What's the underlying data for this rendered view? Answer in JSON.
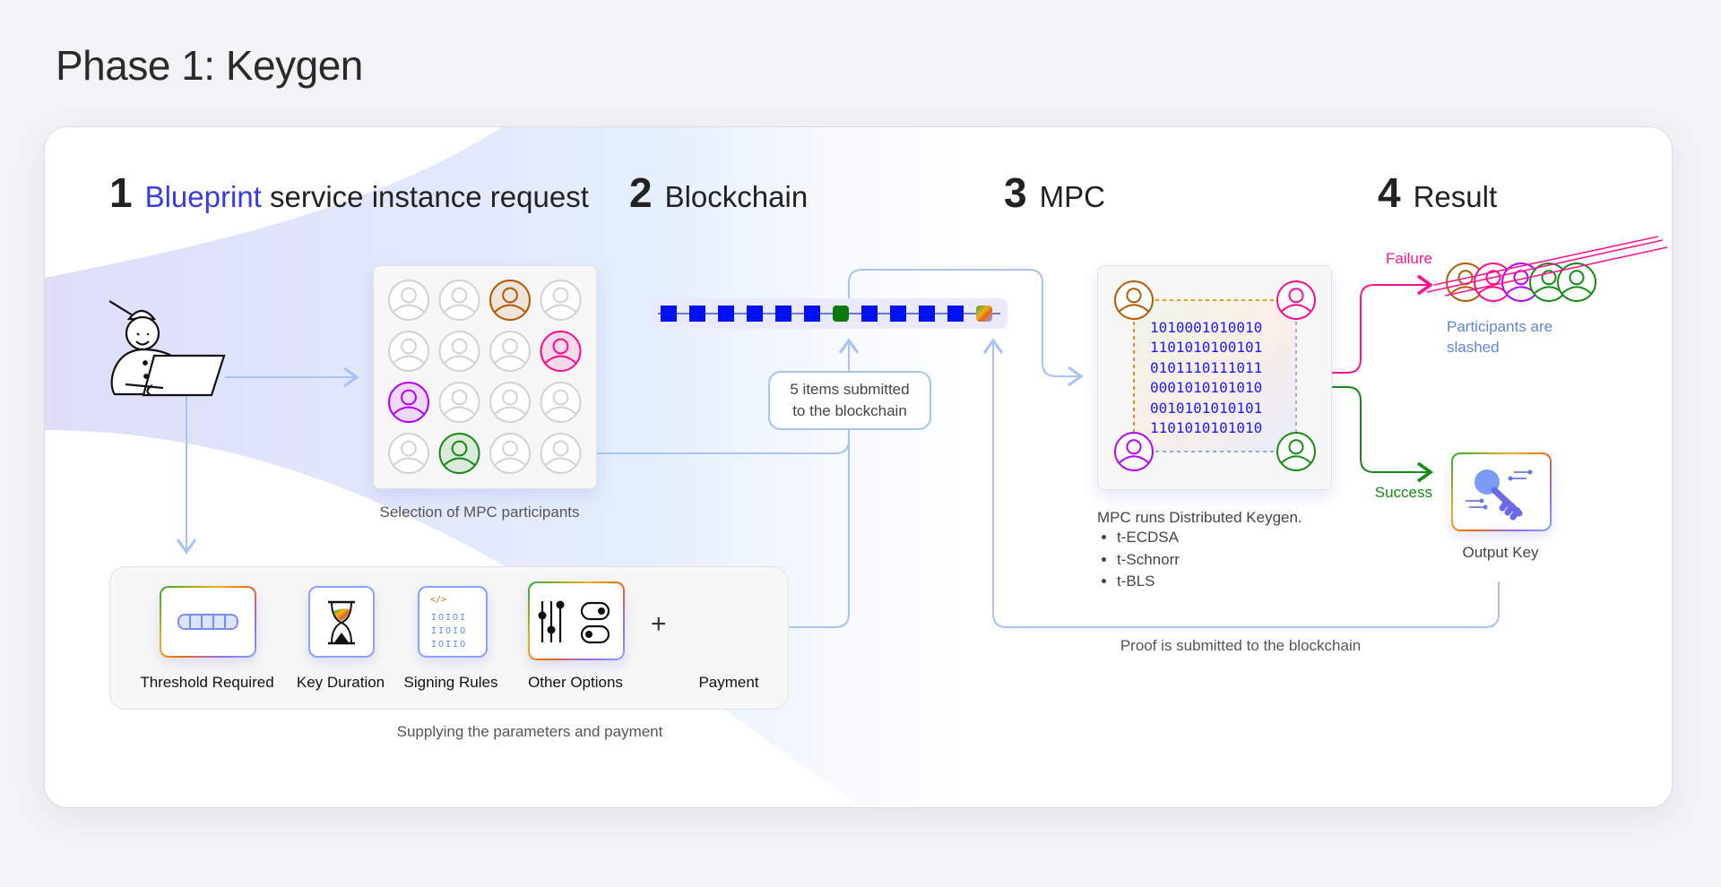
{
  "title": "Phase 1: Keygen",
  "steps": [
    {
      "number": "1",
      "accent": "Blueprint",
      "text": " service instance request"
    },
    {
      "number": "2",
      "text": "Blockchain"
    },
    {
      "number": "3",
      "text": "MPC"
    },
    {
      "number": "4",
      "text": "Result"
    }
  ],
  "colors": {
    "accent": "#3a3ae8",
    "failure": "#ff1493",
    "success": "#178a17",
    "connector": "#a9c4f3",
    "block": "#0010f5",
    "block_highlight": "#0a7a0a",
    "inactive": "#d2d2d2"
  },
  "participants": {
    "caption": "Selection of MPC participants",
    "grid": [
      [
        "inactive",
        "inactive",
        "#b35a00",
        "inactive"
      ],
      [
        "inactive",
        "inactive",
        "inactive",
        "#ff0a8c"
      ],
      [
        "#b300ff",
        "inactive",
        "inactive",
        "inactive"
      ],
      [
        "inactive",
        "#148a14",
        "inactive",
        "inactive"
      ]
    ]
  },
  "blockchain": {
    "blocks": [
      "blue",
      "blue",
      "blue",
      "blue",
      "blue",
      "blue",
      "green",
      "blue",
      "blue",
      "blue",
      "blue",
      "gradient"
    ],
    "callout": [
      "5 items submitted",
      "to the blockchain"
    ]
  },
  "mpc": {
    "corners": [
      "#b35a00",
      "#ff0a8c",
      "#b300ff",
      "#148a14"
    ],
    "binary": [
      "1010001010010",
      "1101010100101",
      "0101110111011",
      "0001010101010",
      "0010101010101",
      "1101010101010"
    ],
    "caption": "MPC runs Distributed Keygen.",
    "algorithms": [
      "t-ECDSA",
      "t-Schnorr",
      "t-BLS"
    ]
  },
  "result": {
    "failure_label": "Failure",
    "slashed_colors": [
      "#b35a00",
      "#ff0a8c",
      "#b300ff",
      "#148a14",
      "#148a14"
    ],
    "slashed_text": [
      "Participants are",
      "slashed"
    ],
    "success_label": "Success",
    "output_label": "Output Key"
  },
  "proof_caption": "Proof is submitted to the blockchain",
  "parameters": {
    "items": [
      {
        "label": "Threshold Required",
        "icon": "threshold-bar-icon"
      },
      {
        "label": "Key Duration",
        "icon": "hourglass-icon"
      },
      {
        "label": "Signing Rules",
        "icon": "code-binary-icon"
      },
      {
        "label": "Other Options",
        "icon": "sliders-toggles-icon"
      },
      {
        "label": "Payment",
        "icon": "payment-coin-icon"
      }
    ],
    "plus": "+",
    "caption": "Supplying the parameters and payment",
    "signing_code": "</>",
    "signing_binary": [
      "IOIOI",
      "IIOIO",
      "IOIIO"
    ]
  }
}
